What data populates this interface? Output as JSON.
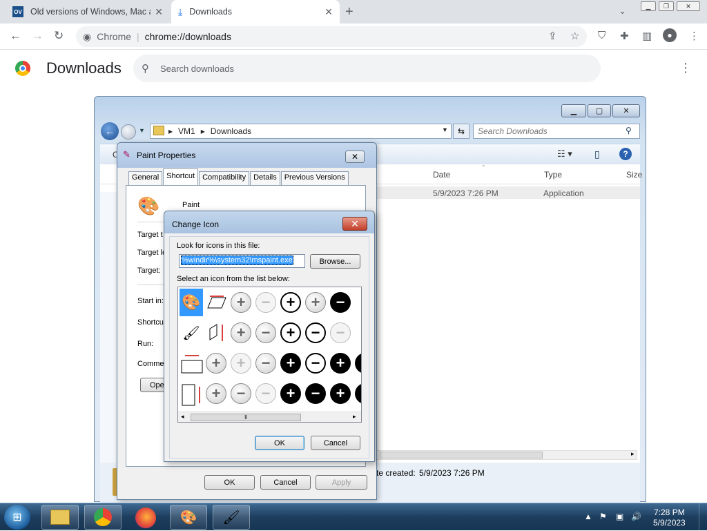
{
  "browser": {
    "tabs": [
      {
        "title": "Old versions of Windows, Mac an",
        "favicon": "OV"
      },
      {
        "title": "Downloads"
      }
    ],
    "new_tab": "+",
    "omnibox_origin": "Chrome",
    "omnibox_url": "chrome://downloads"
  },
  "downloads": {
    "title": "Downloads",
    "search_placeholder": "Search downloads"
  },
  "explorer": {
    "path": [
      "VM1",
      "Downloads"
    ],
    "search_placeholder": "Search Downloads",
    "columns": [
      "Date",
      "Type",
      "Size"
    ],
    "row": {
      "date": "5/9/2023 7:26 PM",
      "type": "Application"
    },
    "status_label": "te created:",
    "status_value": "5/9/2023 7:26 PM"
  },
  "properties": {
    "title": "Paint Properties",
    "tabs": [
      "General",
      "Shortcut",
      "Compatibility",
      "Details",
      "Previous Versions"
    ],
    "active_tab": "Shortcut",
    "name": "Paint",
    "fields": [
      "Target t",
      "Target lo",
      "Target:",
      "Start in:",
      "Shortcut",
      "Run:",
      "Commen"
    ],
    "open_btn": "Ope",
    "ok": "OK",
    "cancel": "Cancel",
    "apply": "Apply"
  },
  "change_icon": {
    "title": "Change Icon",
    "look_label": "Look for icons in this file:",
    "file": "%windir%\\system32\\mspaint.exe",
    "browse": "Browse...",
    "select_label": "Select an icon from the list below:",
    "ok": "OK",
    "cancel": "Cancel"
  },
  "taskbar": {
    "time": "7:28 PM",
    "date": "5/9/2023"
  }
}
